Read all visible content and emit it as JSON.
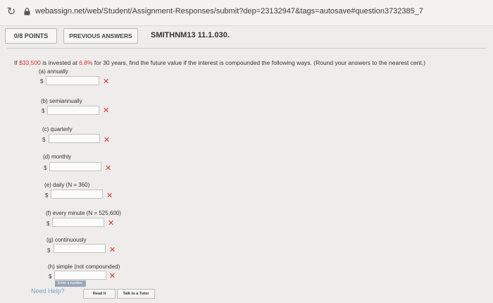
{
  "browser": {
    "url": "webassign.net/web/Student/Assignment-Responses/submit?dep=23132947&tags=autosave#question3732385_7"
  },
  "header": {
    "points": "0/8 POINTS",
    "previous_answers": "PREVIOUS ANSWERS",
    "problem_code": "SMITHNM13 11.1.030."
  },
  "question": {
    "pre": "If ",
    "principal": "$33,500",
    "mid": " is invested at ",
    "rate": "6.8%",
    "post": " for 30 years, find the future value if the interest is compounded the following ways. (Round your answers to the nearest cent.)"
  },
  "parts": [
    {
      "label": "(a) annually",
      "currency": "$",
      "value": ""
    },
    {
      "label": "(b) semiannually",
      "currency": "$",
      "value": ""
    },
    {
      "label": "(c) quarterly",
      "currency": "$",
      "value": ""
    },
    {
      "label": "(d) monthly",
      "currency": "$",
      "value": ""
    },
    {
      "label": "(e) daily (N = 360)",
      "currency": "$",
      "value": ""
    },
    {
      "label": "(f) every minute (N = 525,600)",
      "currency": "$",
      "value": ""
    },
    {
      "label": "(g) continuously",
      "currency": "$",
      "value": ""
    },
    {
      "label": "(h) simple (not compounded)",
      "currency": "$",
      "value": ""
    }
  ],
  "incorrect_mark": "✕",
  "tooltip": "Enter a number.",
  "help": {
    "label": "Need Help?",
    "read_it": "Read It",
    "talk_to_tutor": "Talk to a Tutor"
  },
  "colors": {
    "incorrect": "#d0342c",
    "help_link": "#7ba0c7"
  }
}
